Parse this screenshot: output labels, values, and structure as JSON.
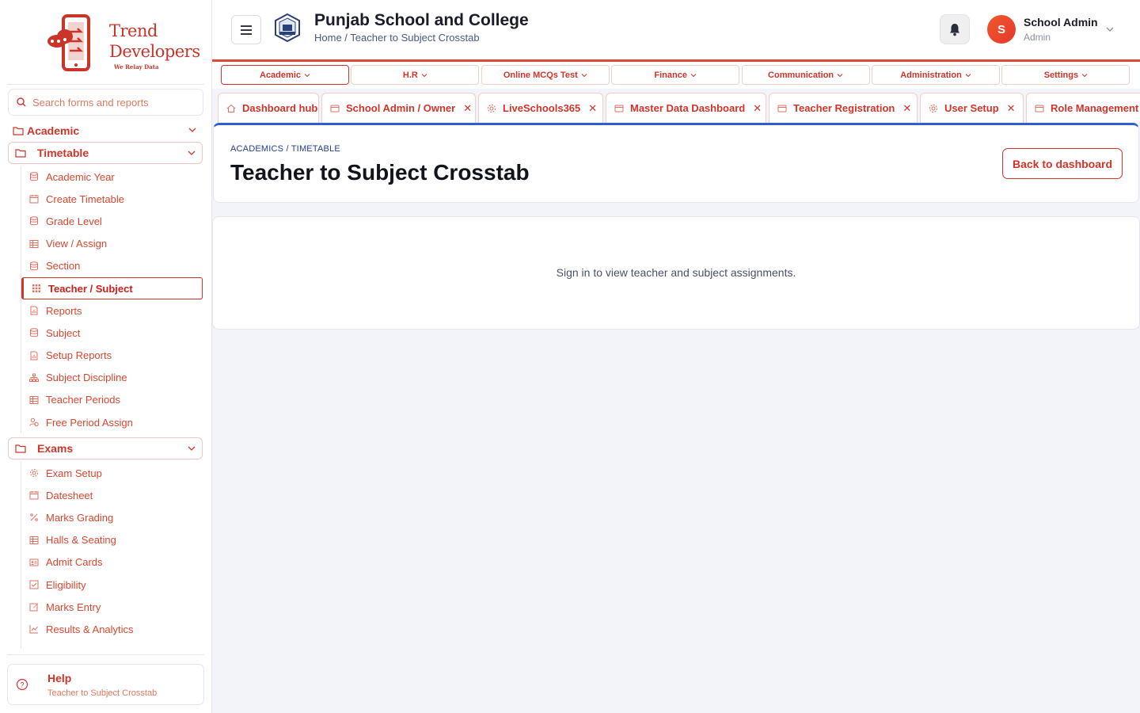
{
  "brand": {
    "line1": "Trend",
    "line2": "Developers",
    "tagline": "We Relay Data"
  },
  "search": {
    "placeholder": "Search forms and reports"
  },
  "sidebar": {
    "academic_label": "Academic",
    "timetable": {
      "label": "Timetable",
      "items": [
        {
          "label": "Academic Year",
          "icon": "database-icon"
        },
        {
          "label": "Create Timetable",
          "icon": "calendar-icon"
        },
        {
          "label": "Grade Level",
          "icon": "database-icon"
        },
        {
          "label": "View / Assign",
          "icon": "table-icon"
        },
        {
          "label": "Section",
          "icon": "database-icon"
        },
        {
          "label": "Teacher / Subject",
          "icon": "grid-icon",
          "active": true
        },
        {
          "label": "Reports",
          "icon": "report-icon"
        },
        {
          "label": "Subject",
          "icon": "database-icon"
        },
        {
          "label": "Setup Reports",
          "icon": "report-icon"
        },
        {
          "label": "Subject Discipline",
          "icon": "hierarchy-icon"
        },
        {
          "label": "Teacher Periods",
          "icon": "table-icon"
        },
        {
          "label": "Free Period Assign",
          "icon": "user-clock-icon"
        }
      ]
    },
    "exams": {
      "label": "Exams",
      "items": [
        {
          "label": "Exam Setup",
          "icon": "gear-icon"
        },
        {
          "label": "Datesheet",
          "icon": "calendar-icon"
        },
        {
          "label": "Marks Grading",
          "icon": "percent-icon"
        },
        {
          "label": "Halls & Seating",
          "icon": "table-icon"
        },
        {
          "label": "Admit Cards",
          "icon": "id-card-icon"
        },
        {
          "label": "Eligibility",
          "icon": "check-square-icon"
        },
        {
          "label": "Marks Entry",
          "icon": "edit-icon"
        },
        {
          "label": "Results & Analytics",
          "icon": "chart-icon"
        }
      ]
    },
    "help": {
      "title": "Help",
      "subtitle": "Teacher to Subject Crosstab"
    }
  },
  "header": {
    "school_name": "Punjab School and College",
    "breadcrumb": "Home / Teacher to Subject Crosstab",
    "user": {
      "initial": "S",
      "name": "School Admin",
      "role": "Admin"
    }
  },
  "modules": [
    {
      "label": "Academic",
      "active": true
    },
    {
      "label": "H.R"
    },
    {
      "label": "Online MCQs Test"
    },
    {
      "label": "Finance"
    },
    {
      "label": "Communication"
    },
    {
      "label": "Administration"
    },
    {
      "label": "Settings"
    }
  ],
  "tabs": [
    {
      "label": "Dashboard hub",
      "icon": "home-icon",
      "closable": false
    },
    {
      "label": "School Admin / Owner",
      "icon": "window-icon",
      "closable": true
    },
    {
      "label": "LiveSchools365",
      "icon": "gear-icon",
      "closable": true
    },
    {
      "label": "Master Data Dashboard",
      "icon": "window-icon",
      "closable": true
    },
    {
      "label": "Teacher Registration",
      "icon": "window-icon",
      "closable": true
    },
    {
      "label": "User Setup",
      "icon": "gear-icon",
      "closable": true
    },
    {
      "label": "Role Management",
      "icon": "window-icon",
      "closable": false
    }
  ],
  "page": {
    "breadcrumb": "ACADEMICS / TIMETABLE",
    "title": "Teacher to Subject Crosstab",
    "back_label": "Back to dashboard",
    "message": "Sign in to view teacher and subject assignments."
  },
  "colors": {
    "accent": "#d1352a",
    "title_border": "#2f5fd0",
    "avatar": "#e6372a"
  }
}
